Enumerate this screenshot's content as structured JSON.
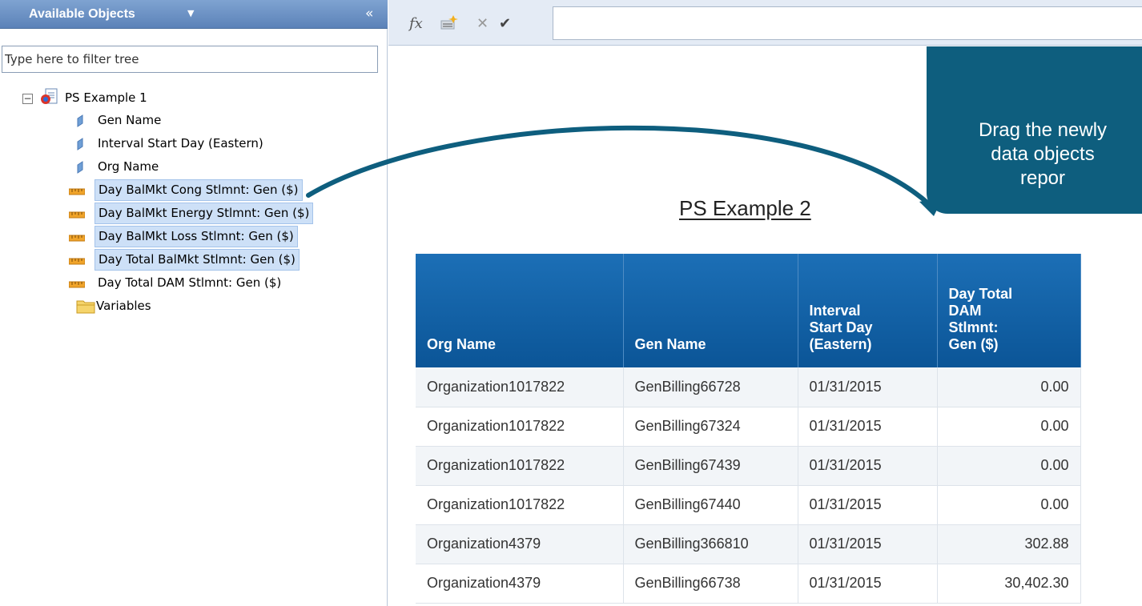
{
  "panel": {
    "title": "Available Objects",
    "title_dropdown_glyph": "▼",
    "collapse_glyph": "«",
    "filter_placeholder": "Type here to filter tree"
  },
  "tree": {
    "root": {
      "label": "PS Example 1",
      "icon": "document-icon",
      "expander": "−"
    },
    "children": [
      {
        "label": "Gen Name",
        "icon": "dimension-icon",
        "selected": false
      },
      {
        "label": "Interval Start Day (Eastern)",
        "icon": "dimension-icon",
        "selected": false
      },
      {
        "label": "Org Name",
        "icon": "dimension-icon",
        "selected": false
      },
      {
        "label": "Day BalMkt Cong Stlmnt: Gen ($)",
        "icon": "measure-icon",
        "selected": true
      },
      {
        "label": "Day BalMkt Energy Stlmnt: Gen ($)",
        "icon": "measure-icon",
        "selected": true
      },
      {
        "label": "Day BalMkt Loss Stlmnt: Gen ($)",
        "icon": "measure-icon",
        "selected": true
      },
      {
        "label": "Day Total BalMkt Stlmnt: Gen ($)",
        "icon": "measure-icon",
        "selected": true
      },
      {
        "label": "Day Total DAM Stlmnt: Gen ($)",
        "icon": "measure-icon",
        "selected": false
      },
      {
        "label": "Variables",
        "icon": "folder-icon",
        "selected": false
      }
    ]
  },
  "formula_bar": {
    "fx_glyph": "fx",
    "cancel_glyph": "✕",
    "validate_glyph": "✔",
    "value": ""
  },
  "report": {
    "title": "PS Example 2",
    "callout": {
      "line1": "Drag the newly",
      "line2": "data objects",
      "line3": "repor"
    },
    "columns": [
      "Org Name",
      "Gen Name",
      "Interval Start Day (Eastern)",
      "Day Total DAM Stlmnt: Gen ($)"
    ],
    "header_lines": [
      [
        "Org Name"
      ],
      [
        "Gen Name"
      ],
      [
        "Interval",
        "Start Day",
        "(Eastern)"
      ],
      [
        "Day Total",
        "DAM",
        "Stlmnt:",
        "Gen ($)"
      ]
    ],
    "rows": [
      [
        "Organization1017822",
        "GenBilling66728",
        "01/31/2015",
        "0.00"
      ],
      [
        "Organization1017822",
        "GenBilling67324",
        "01/31/2015",
        "0.00"
      ],
      [
        "Organization1017822",
        "GenBilling67439",
        "01/31/2015",
        "0.00"
      ],
      [
        "Organization1017822",
        "GenBilling67440",
        "01/31/2015",
        "0.00"
      ],
      [
        "Organization4379",
        "GenBilling366810",
        "01/31/2015",
        "302.88"
      ],
      [
        "Organization4379",
        "GenBilling66738",
        "01/31/2015",
        "30,402.30"
      ]
    ]
  },
  "colors": {
    "panel_header": "#6b91c6",
    "selection": "#cde0f7",
    "table_header": "#115fa6",
    "callout": "#0e5e7e",
    "arrow": "#0e5e7e"
  }
}
